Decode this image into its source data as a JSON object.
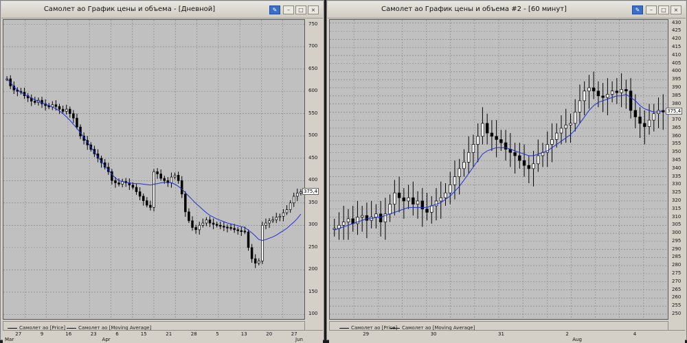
{
  "windows": [
    {
      "title": "Самолет ао График цены и объема - [Дневной]",
      "current_price": "375,4",
      "legend": [
        "Самолет ао [Price]",
        "Самолет ао [Moving Average]"
      ],
      "x_ticks": [
        "27",
        "9",
        "16",
        "23",
        "6",
        "15",
        "21",
        "28",
        "5",
        "13",
        "20",
        "27"
      ],
      "x_subticks": [
        "Mar",
        "Apr",
        "Jun"
      ],
      "y_ticks": [
        750,
        700,
        650,
        600,
        550,
        500,
        450,
        400,
        350,
        300,
        250,
        200,
        150,
        100
      ],
      "ylim": [
        90,
        760
      ],
      "price": [
        628,
        612,
        603,
        600,
        598,
        590,
        585,
        578,
        575,
        580,
        572,
        568,
        565,
        570,
        566,
        560,
        555,
        560,
        550,
        540,
        520,
        500,
        490,
        480,
        470,
        460,
        450,
        440,
        430,
        420,
        400,
        395,
        392,
        398,
        395,
        390,
        385,
        375,
        365,
        355,
        345,
        340,
        420,
        415,
        405,
        400,
        395,
        408,
        412,
        400,
        370,
        330,
        310,
        295,
        290,
        300,
        305,
        312,
        305,
        302,
        300,
        298,
        296,
        295,
        293,
        290,
        288,
        287,
        285,
        250,
        225,
        215,
        220,
        300,
        305,
        310,
        312,
        318,
        320,
        328,
        335,
        350,
        365,
        372,
        375
      ],
      "ma": [
        628,
        620,
        610,
        603,
        598,
        593,
        589,
        585,
        581,
        578,
        574,
        571,
        568,
        565,
        561,
        556,
        550,
        543,
        535,
        526,
        517,
        507,
        497,
        486,
        475,
        464,
        453,
        443,
        433,
        424,
        414,
        406,
        400,
        398,
        396,
        395,
        394,
        393,
        393,
        392,
        391,
        390,
        392,
        393,
        395,
        396,
        396,
        395,
        392,
        387,
        381,
        373,
        365,
        357,
        349,
        342,
        335,
        328,
        322,
        318,
        314,
        311,
        308,
        305,
        303,
        301,
        299,
        297,
        295,
        289,
        283,
        276,
        268,
        266,
        268,
        271,
        274,
        278,
        283,
        288,
        293,
        300,
        307,
        315,
        325
      ]
    },
    {
      "title": "Самолет ао График цены и объема #2 - [60 минут]",
      "current_price": "375,4",
      "legend": [
        "Самолет ао [Price]",
        "Самолет ао [Moving Average]"
      ],
      "x_ticks": [
        "29",
        "30",
        "31",
        "2",
        "4"
      ],
      "x_subticks": [
        "Aug"
      ],
      "y_ticks": [
        430,
        425,
        420,
        415,
        410,
        405,
        400,
        395,
        390,
        385,
        380,
        375,
        370,
        365,
        360,
        355,
        350,
        345,
        340,
        335,
        330,
        325,
        320,
        315,
        310,
        305,
        300,
        295,
        290,
        285,
        280,
        275,
        270,
        265,
        260,
        255,
        250
      ],
      "ylim": [
        247,
        432
      ],
      "price": [
        303,
        305,
        307,
        309,
        306,
        310,
        311,
        308,
        310,
        312,
        307,
        312,
        318,
        325,
        322,
        320,
        322,
        318,
        320,
        315,
        313,
        317,
        320,
        322,
        325,
        330,
        335,
        340,
        344,
        350,
        355,
        360,
        368,
        362,
        360,
        358,
        356,
        352,
        350,
        348,
        345,
        342,
        340,
        343,
        348,
        350,
        355,
        358,
        362,
        365,
        367,
        368,
        375,
        382,
        388,
        390,
        388,
        385,
        384,
        386,
        388,
        387,
        389,
        388,
        376,
        372,
        368,
        366,
        370,
        374,
        376,
        375
      ],
      "ma": [
        302,
        303,
        304,
        305,
        306,
        307,
        308,
        309,
        309,
        310,
        310,
        311,
        312,
        313,
        314,
        315,
        316,
        316,
        316,
        316,
        316,
        317,
        318,
        319,
        321,
        323,
        326,
        329,
        333,
        337,
        341,
        345,
        349,
        351,
        352,
        353,
        353,
        353,
        352,
        351,
        350,
        349,
        348,
        348,
        349,
        350,
        351,
        353,
        355,
        357,
        359,
        361,
        364,
        368,
        372,
        376,
        379,
        381,
        382,
        383,
        384,
        385,
        385,
        386,
        384,
        382,
        379,
        377,
        376,
        375,
        375,
        376
      ]
    }
  ],
  "colors": {
    "price": "#000000",
    "ma": "#1d2fd6",
    "plot_bg": "#c0c0c0",
    "grid": "#808080"
  }
}
